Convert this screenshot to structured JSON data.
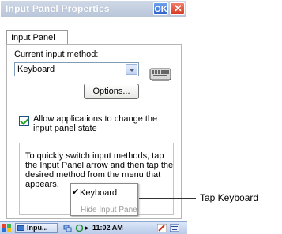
{
  "window": {
    "title": "Input Panel Properties",
    "ok_label": "OK",
    "close_label": "✕"
  },
  "tabs": [
    {
      "label": "Input Panel"
    }
  ],
  "input_method": {
    "label": "Current input method:",
    "selected": "Keyboard"
  },
  "options_button": {
    "label": "Options..."
  },
  "allow_checkbox": {
    "checked": true,
    "label": "Allow applications to change the input panel state"
  },
  "info_text": "To quickly switch input methods, tap the Input Panel arrow and then tap the desired method from the menu that appears.",
  "popup_menu": {
    "items": [
      {
        "label": "Keyboard",
        "checked": true,
        "enabled": true
      },
      {
        "label": "Hide Input Panel",
        "checked": false,
        "enabled": false
      }
    ]
  },
  "callout": {
    "text": "Tap Keyboard"
  },
  "taskbar": {
    "app_label": "Inpu...",
    "arrow": "▸",
    "clock": "11:02 AM"
  },
  "colors": {
    "title_bar": "#c3cee0",
    "ok_button": "#3a6fd6",
    "close_button": "#e0543d",
    "checkmark": "#21a121",
    "taskbar": "#c6d6ef"
  }
}
